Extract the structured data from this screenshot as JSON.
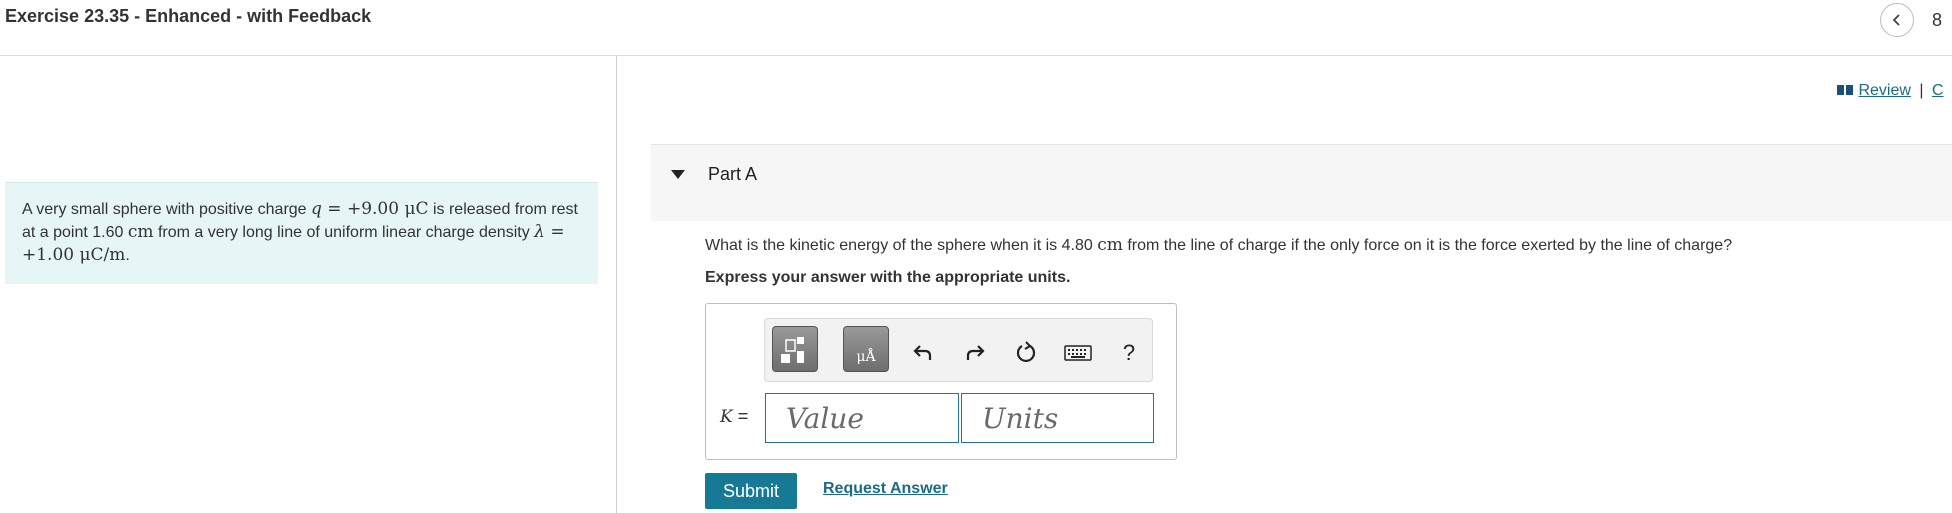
{
  "header": {
    "title": "Exercise 23.35 - Enhanced - with Feedback",
    "page_number": "8"
  },
  "problem": {
    "t1": "A very small sphere with positive charge ",
    "q_var": "q",
    "q_value": " = +9.00 ",
    "q_unit": "μC",
    "t2": " is released from rest at a point 1.60 ",
    "dist_unit": "cm",
    "t3": " from a very long line of uniform linear charge density ",
    "lambda_var": "λ",
    "lambda_value": " = +1.00 ",
    "lambda_unit": "μC/m",
    "t4": "."
  },
  "review": {
    "label": "Review",
    "separator": "|",
    "next": "C"
  },
  "part_a": {
    "title": "Part A",
    "question_pre": "What is the kinetic energy of the sphere when it is 4.80 ",
    "question_unit": "cm",
    "question_post": " from the line of charge if the only force on it is the force exerted by the line of charge?",
    "instructions": "Express your answer with the appropriate units."
  },
  "toolbar": {
    "units_label": "μÅ",
    "help": "?"
  },
  "answer": {
    "label_var": "K",
    "label_eq": " =",
    "value_placeholder": "Value",
    "units_placeholder": "Units",
    "value": "",
    "units": ""
  },
  "actions": {
    "submit": "Submit",
    "request_answer": "Request Answer"
  },
  "colors": {
    "accent": "#167a94",
    "problem_bg": "#e6f5f5",
    "link": "#1a6a8a"
  }
}
